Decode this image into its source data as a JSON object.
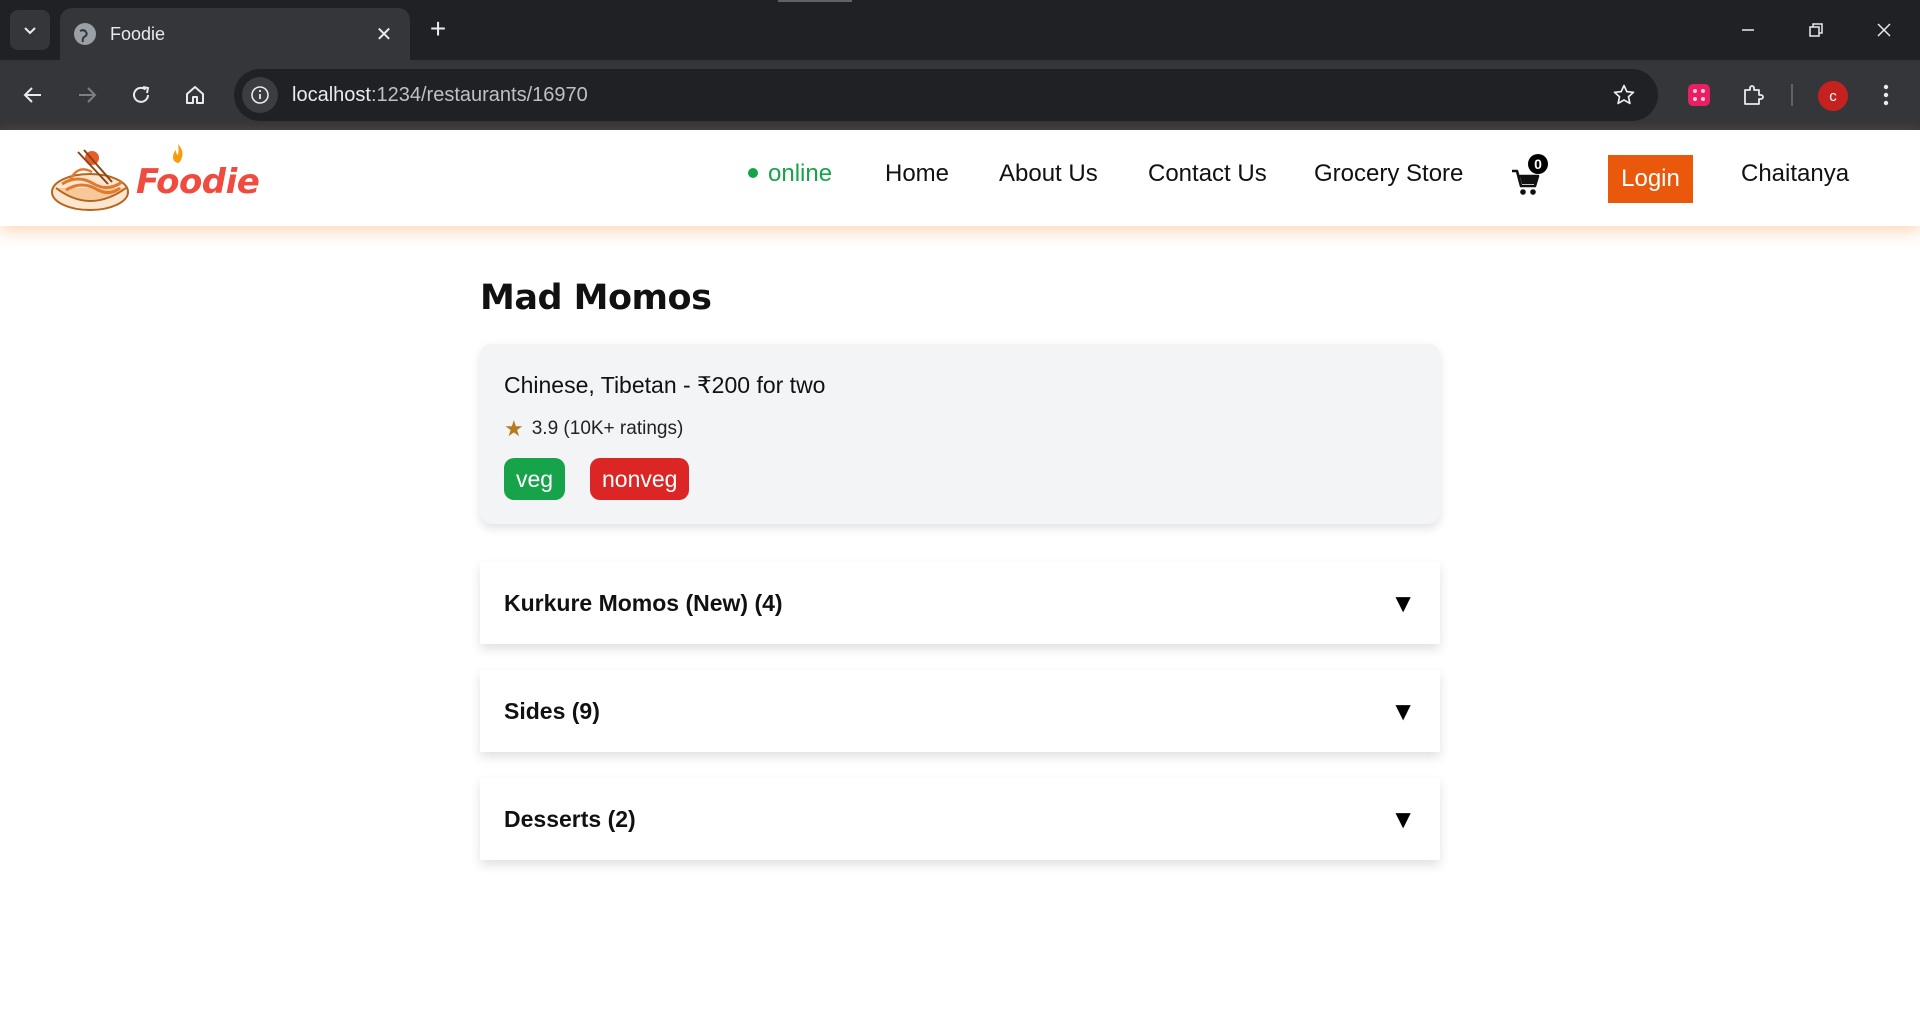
{
  "browser": {
    "tab_title": "Foodie",
    "url_host": "localhost",
    "url_path": ":1234/restaurants/16970",
    "profile_initial": "c"
  },
  "site": {
    "logo_text": "Foodie",
    "status_label": "online",
    "nav": {
      "home": "Home",
      "about": "About Us",
      "contact": "Contact Us",
      "grocery": "Grocery Store"
    },
    "cart_count": "0",
    "login_label": "Login",
    "user_name": "Chaitanya"
  },
  "restaurant": {
    "name": "Mad Momos",
    "cuisines_cost": "Chinese, Tibetan - ₹200 for two",
    "rating_text": "3.9 (10K+ ratings)",
    "tags": {
      "veg": "veg",
      "nonveg": "nonveg"
    }
  },
  "menu_categories": [
    {
      "title": "Kurkure Momos (New) (4)"
    },
    {
      "title": "Sides (9)"
    },
    {
      "title": "Desserts (2)"
    }
  ],
  "icons": {
    "tab_search": "chevron-down-icon",
    "favicon": "globe-icon",
    "close": "close-icon",
    "new_tab": "plus-icon",
    "back": "arrow-left-icon",
    "forward": "arrow-right-icon",
    "reload": "reload-icon",
    "home": "home-icon",
    "site_info": "info-icon",
    "bookmark": "star-icon",
    "extension": "puzzle-icon",
    "menu": "more-vert-icon",
    "cart": "cart-icon",
    "rating_star": "star-icon",
    "expand": "triangle-down-icon"
  },
  "colors": {
    "status": "#16a34a",
    "login_bg": "#ea580c",
    "veg": "#16a34a",
    "nonveg": "#dc2626",
    "brand": "#f04b3f",
    "rating_star": "#b7791f"
  }
}
